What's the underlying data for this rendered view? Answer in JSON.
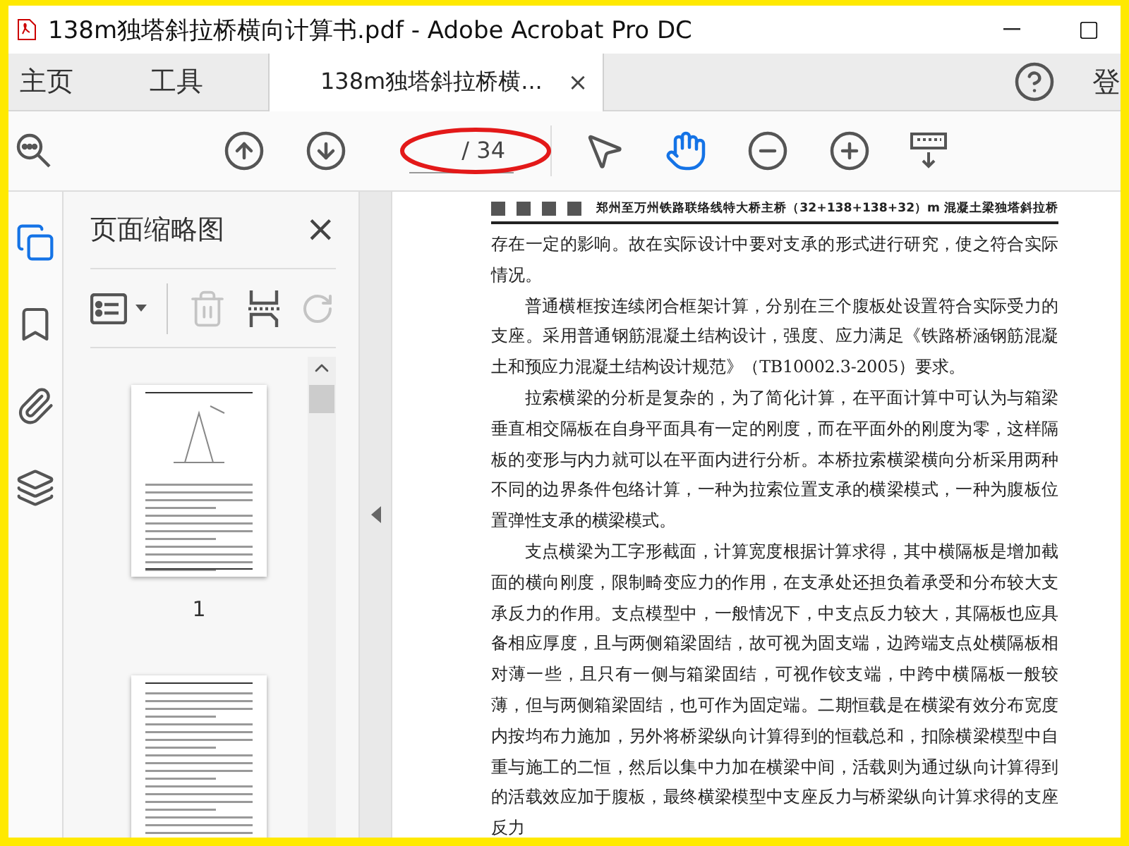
{
  "window": {
    "title": "138m独塔斜拉桥横向计算书.pdf - Adobe Acrobat Pro DC"
  },
  "tabs": [
    {
      "kind": "nav",
      "label": "主页",
      "selected": false
    },
    {
      "kind": "nav",
      "label": "工具",
      "selected": false
    },
    {
      "kind": "document",
      "label": "138m独塔斜拉桥横...",
      "close": "×",
      "selected": true
    }
  ],
  "account": {
    "label": "登"
  },
  "toolbar": {
    "tools": [
      {
        "kind": "find",
        "selected": false
      },
      {
        "kind": "prev-page",
        "selected": false
      },
      {
        "kind": "next-page",
        "selected": false
      },
      {
        "kind": "page-field",
        "total": "/ 34",
        "circled": true
      },
      {
        "kind": "select",
        "selected": false
      },
      {
        "kind": "hand",
        "selected": true
      },
      {
        "kind": "zoom-out",
        "selected": false
      },
      {
        "kind": "zoom-in",
        "selected": false
      },
      {
        "kind": "keyboard",
        "selected": false
      }
    ]
  },
  "side_rail": [
    {
      "kind": "pages",
      "selected": true
    },
    {
      "kind": "bookmarks",
      "selected": false
    },
    {
      "kind": "attachments",
      "selected": false
    },
    {
      "kind": "layers",
      "selected": false
    }
  ],
  "thumbnail_panel": {
    "title": "页面缩略图",
    "close": "×",
    "tools": [
      {
        "kind": "options",
        "disabled": false
      },
      {
        "kind": "delete",
        "disabled": true
      },
      {
        "kind": "insert",
        "disabled": false
      },
      {
        "kind": "rotate",
        "disabled": true
      }
    ],
    "thumbnails": [
      {
        "kind": "full",
        "label": "1"
      },
      {
        "kind": "partial"
      }
    ]
  },
  "document": {
    "header": "郑州至万州铁路联络线特大桥主桥（32+138+138+32）m 混凝土梁独塔斜拉桥",
    "paragraphs": [
      {
        "indent": false,
        "text": "存在一定的影响。故在实际设计中要对支承的形式进行研究，使之符合实际情况。"
      },
      {
        "indent": true,
        "text": "普通横框按连续闭合框架计算，分别在三个腹板处设置符合实际受力的支座。采用普通钢筋混凝土结构设计，强度、应力满足《铁路桥涵钢筋混凝土和预应力混凝土结构设计规范》（TB10002.3-2005）要求。"
      },
      {
        "indent": true,
        "text": "拉索横梁的分析是复杂的，为了简化计算，在平面计算中可认为与箱梁垂直相交隔板在自身平面具有一定的刚度，而在平面外的刚度为零，这样隔板的变形与内力就可以在平面内进行分析。本桥拉索横梁横向分析采用两种不同的边界条件包络计算，一种为拉索位置支承的横梁模式，一种为腹板位置弹性支承的横梁模式。"
      },
      {
        "indent": true,
        "text": "支点横梁为工字形截面，计算宽度根据计算求得，其中横隔板是增加截面的横向刚度，限制畸变应力的作用，在支承处还担负着承受和分布较大支承反力的作用。支点模型中，一般情况下，中支点反力较大，其隔板也应具备相应厚度，且与两侧箱梁固结，故可视为固支端，边跨端支点处横隔板相对薄一些，且只有一侧与箱梁固结，可视作铰支端，中跨中横隔板一般较薄，但与两侧箱梁固结，也可作为固定端。二期恒载是在横梁有效分布宽度内按均布力施加，另外将桥梁纵向计算得到的恒载总和，扣除横梁模型中自重与施工的二恒，然后以集中力加在横梁中间，活载则为通过纵向计算得到的活载效应加于腹板，最终横梁模型中支座反力与桥梁纵向计算求得的支座反力"
      }
    ]
  }
}
